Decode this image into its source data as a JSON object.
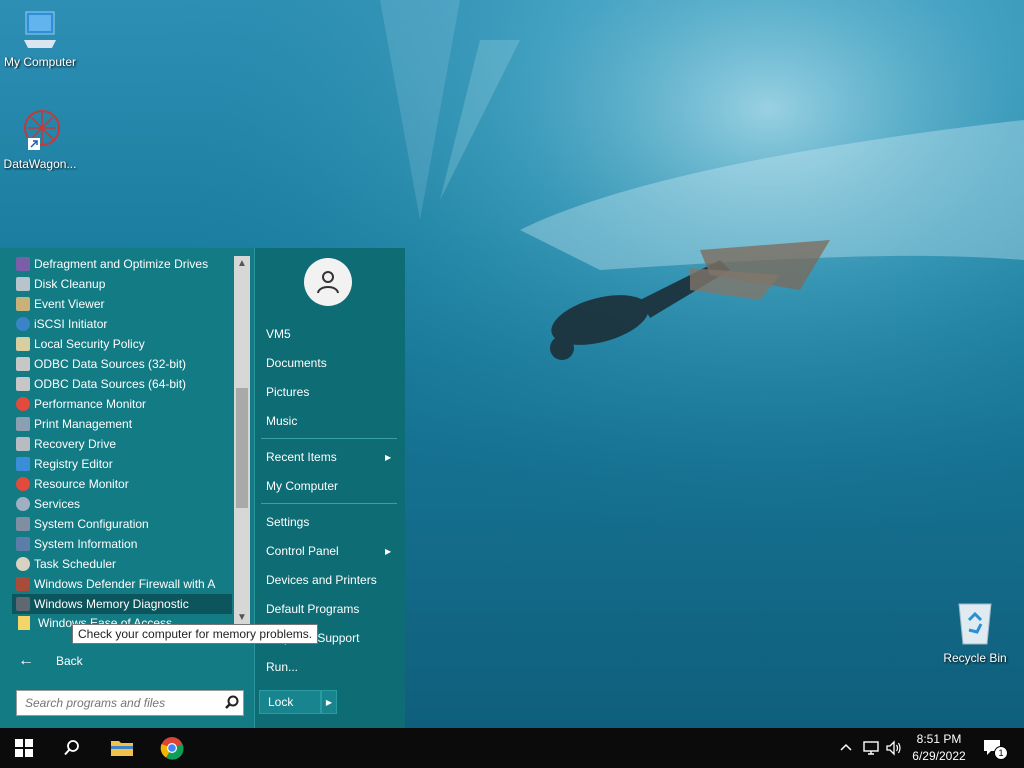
{
  "desktop": {
    "icons": [
      {
        "label": "My Computer"
      },
      {
        "label": "DataWagon..."
      },
      {
        "label": "Recycle Bin"
      }
    ]
  },
  "start_menu": {
    "programs": [
      {
        "label": "Defragment and Optimize Drives",
        "icon": "defrag-icon"
      },
      {
        "label": "Disk Cleanup",
        "icon": "disk-cleanup-icon"
      },
      {
        "label": "Event Viewer",
        "icon": "event-viewer-icon"
      },
      {
        "label": "iSCSI Initiator",
        "icon": "globe-icon"
      },
      {
        "label": "Local Security Policy",
        "icon": "security-policy-icon"
      },
      {
        "label": "ODBC Data Sources (32-bit)",
        "icon": "odbc-icon"
      },
      {
        "label": "ODBC Data Sources (64-bit)",
        "icon": "odbc-icon"
      },
      {
        "label": "Performance Monitor",
        "icon": "gauge-icon"
      },
      {
        "label": "Print Management",
        "icon": "printer-icon"
      },
      {
        "label": "Recovery Drive",
        "icon": "drive-icon"
      },
      {
        "label": "Registry Editor",
        "icon": "registry-icon"
      },
      {
        "label": "Resource Monitor",
        "icon": "gauge-icon"
      },
      {
        "label": "Services",
        "icon": "gears-icon"
      },
      {
        "label": "System Configuration",
        "icon": "config-icon"
      },
      {
        "label": "System Information",
        "icon": "info-icon"
      },
      {
        "label": "Task Scheduler",
        "icon": "clock-icon"
      },
      {
        "label": "Windows Defender Firewall with A",
        "icon": "firewall-icon"
      },
      {
        "label": "Windows Memory Diagnostic",
        "icon": "memory-icon"
      }
    ],
    "folder_label": "Windows Ease of Access",
    "tooltip": "Check your computer for memory problems.",
    "back_label": "Back",
    "search_placeholder": "Search programs and files",
    "user": "VM5",
    "right_items": {
      "documents": "Documents",
      "pictures": "Pictures",
      "music": "Music",
      "recent_items": "Recent Items",
      "my_computer": "My Computer",
      "settings": "Settings",
      "control_panel": "Control Panel",
      "devices_printers": "Devices and Printers",
      "default_programs": "Default Programs",
      "help_support": "Help and Support",
      "run": "Run..."
    },
    "lock_label": "Lock"
  },
  "taskbar": {
    "time": "8:51 PM",
    "date": "6/29/2022",
    "notification_count": "1"
  },
  "colors": {
    "menu_left": "#137b84",
    "menu_right": "#0e6c74",
    "taskbar": "#0b0b0b"
  }
}
